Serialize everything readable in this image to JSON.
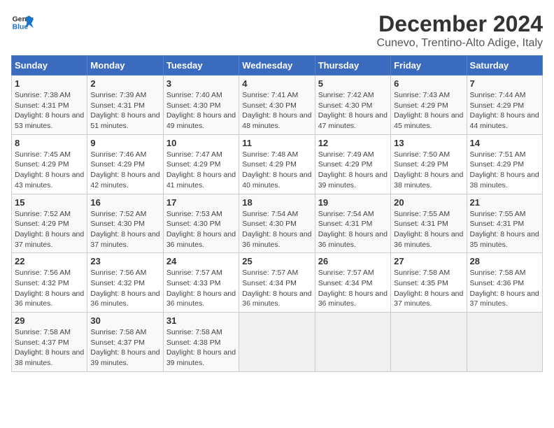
{
  "logo": {
    "text_general": "General",
    "text_blue": "Blue"
  },
  "header": {
    "title": "December 2024",
    "subtitle": "Cunevo, Trentino-Alto Adige, Italy"
  },
  "weekdays": [
    "Sunday",
    "Monday",
    "Tuesday",
    "Wednesday",
    "Thursday",
    "Friday",
    "Saturday"
  ],
  "weeks": [
    [
      {
        "day": "1",
        "sunrise": "Sunrise: 7:38 AM",
        "sunset": "Sunset: 4:31 PM",
        "daylight": "Daylight: 8 hours and 53 minutes."
      },
      {
        "day": "2",
        "sunrise": "Sunrise: 7:39 AM",
        "sunset": "Sunset: 4:31 PM",
        "daylight": "Daylight: 8 hours and 51 minutes."
      },
      {
        "day": "3",
        "sunrise": "Sunrise: 7:40 AM",
        "sunset": "Sunset: 4:30 PM",
        "daylight": "Daylight: 8 hours and 49 minutes."
      },
      {
        "day": "4",
        "sunrise": "Sunrise: 7:41 AM",
        "sunset": "Sunset: 4:30 PM",
        "daylight": "Daylight: 8 hours and 48 minutes."
      },
      {
        "day": "5",
        "sunrise": "Sunrise: 7:42 AM",
        "sunset": "Sunset: 4:30 PM",
        "daylight": "Daylight: 8 hours and 47 minutes."
      },
      {
        "day": "6",
        "sunrise": "Sunrise: 7:43 AM",
        "sunset": "Sunset: 4:29 PM",
        "daylight": "Daylight: 8 hours and 45 minutes."
      },
      {
        "day": "7",
        "sunrise": "Sunrise: 7:44 AM",
        "sunset": "Sunset: 4:29 PM",
        "daylight": "Daylight: 8 hours and 44 minutes."
      }
    ],
    [
      {
        "day": "8",
        "sunrise": "Sunrise: 7:45 AM",
        "sunset": "Sunset: 4:29 PM",
        "daylight": "Daylight: 8 hours and 43 minutes."
      },
      {
        "day": "9",
        "sunrise": "Sunrise: 7:46 AM",
        "sunset": "Sunset: 4:29 PM",
        "daylight": "Daylight: 8 hours and 42 minutes."
      },
      {
        "day": "10",
        "sunrise": "Sunrise: 7:47 AM",
        "sunset": "Sunset: 4:29 PM",
        "daylight": "Daylight: 8 hours and 41 minutes."
      },
      {
        "day": "11",
        "sunrise": "Sunrise: 7:48 AM",
        "sunset": "Sunset: 4:29 PM",
        "daylight": "Daylight: 8 hours and 40 minutes."
      },
      {
        "day": "12",
        "sunrise": "Sunrise: 7:49 AM",
        "sunset": "Sunset: 4:29 PM",
        "daylight": "Daylight: 8 hours and 39 minutes."
      },
      {
        "day": "13",
        "sunrise": "Sunrise: 7:50 AM",
        "sunset": "Sunset: 4:29 PM",
        "daylight": "Daylight: 8 hours and 38 minutes."
      },
      {
        "day": "14",
        "sunrise": "Sunrise: 7:51 AM",
        "sunset": "Sunset: 4:29 PM",
        "daylight": "Daylight: 8 hours and 38 minutes."
      }
    ],
    [
      {
        "day": "15",
        "sunrise": "Sunrise: 7:52 AM",
        "sunset": "Sunset: 4:29 PM",
        "daylight": "Daylight: 8 hours and 37 minutes."
      },
      {
        "day": "16",
        "sunrise": "Sunrise: 7:52 AM",
        "sunset": "Sunset: 4:30 PM",
        "daylight": "Daylight: 8 hours and 37 minutes."
      },
      {
        "day": "17",
        "sunrise": "Sunrise: 7:53 AM",
        "sunset": "Sunset: 4:30 PM",
        "daylight": "Daylight: 8 hours and 36 minutes."
      },
      {
        "day": "18",
        "sunrise": "Sunrise: 7:54 AM",
        "sunset": "Sunset: 4:30 PM",
        "daylight": "Daylight: 8 hours and 36 minutes."
      },
      {
        "day": "19",
        "sunrise": "Sunrise: 7:54 AM",
        "sunset": "Sunset: 4:31 PM",
        "daylight": "Daylight: 8 hours and 36 minutes."
      },
      {
        "day": "20",
        "sunrise": "Sunrise: 7:55 AM",
        "sunset": "Sunset: 4:31 PM",
        "daylight": "Daylight: 8 hours and 36 minutes."
      },
      {
        "day": "21",
        "sunrise": "Sunrise: 7:55 AM",
        "sunset": "Sunset: 4:31 PM",
        "daylight": "Daylight: 8 hours and 35 minutes."
      }
    ],
    [
      {
        "day": "22",
        "sunrise": "Sunrise: 7:56 AM",
        "sunset": "Sunset: 4:32 PM",
        "daylight": "Daylight: 8 hours and 36 minutes."
      },
      {
        "day": "23",
        "sunrise": "Sunrise: 7:56 AM",
        "sunset": "Sunset: 4:32 PM",
        "daylight": "Daylight: 8 hours and 36 minutes."
      },
      {
        "day": "24",
        "sunrise": "Sunrise: 7:57 AM",
        "sunset": "Sunset: 4:33 PM",
        "daylight": "Daylight: 8 hours and 36 minutes."
      },
      {
        "day": "25",
        "sunrise": "Sunrise: 7:57 AM",
        "sunset": "Sunset: 4:34 PM",
        "daylight": "Daylight: 8 hours and 36 minutes."
      },
      {
        "day": "26",
        "sunrise": "Sunrise: 7:57 AM",
        "sunset": "Sunset: 4:34 PM",
        "daylight": "Daylight: 8 hours and 36 minutes."
      },
      {
        "day": "27",
        "sunrise": "Sunrise: 7:58 AM",
        "sunset": "Sunset: 4:35 PM",
        "daylight": "Daylight: 8 hours and 37 minutes."
      },
      {
        "day": "28",
        "sunrise": "Sunrise: 7:58 AM",
        "sunset": "Sunset: 4:36 PM",
        "daylight": "Daylight: 8 hours and 37 minutes."
      }
    ],
    [
      {
        "day": "29",
        "sunrise": "Sunrise: 7:58 AM",
        "sunset": "Sunset: 4:37 PM",
        "daylight": "Daylight: 8 hours and 38 minutes."
      },
      {
        "day": "30",
        "sunrise": "Sunrise: 7:58 AM",
        "sunset": "Sunset: 4:37 PM",
        "daylight": "Daylight: 8 hours and 39 minutes."
      },
      {
        "day": "31",
        "sunrise": "Sunrise: 7:58 AM",
        "sunset": "Sunset: 4:38 PM",
        "daylight": "Daylight: 8 hours and 39 minutes."
      },
      null,
      null,
      null,
      null
    ]
  ]
}
